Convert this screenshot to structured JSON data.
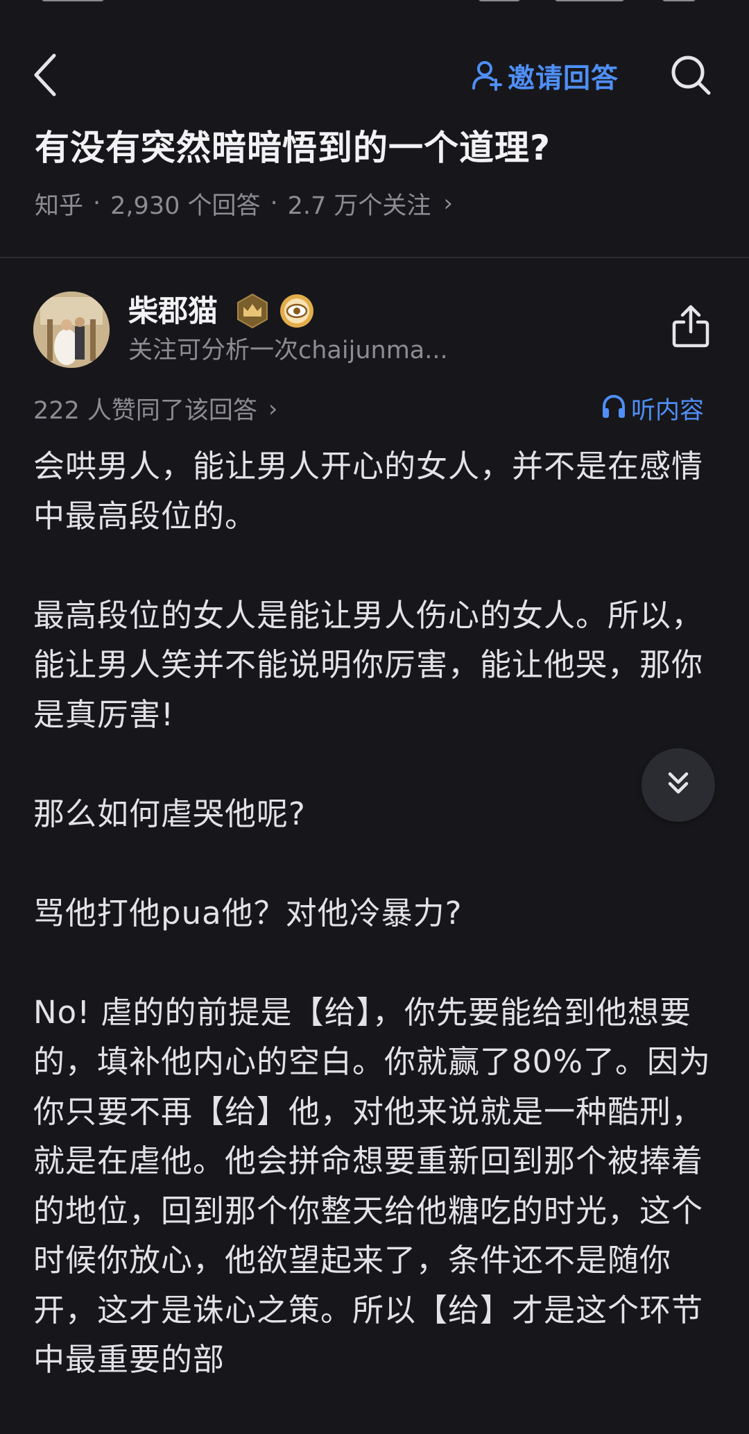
{
  "header": {
    "invite_label": "邀请回答",
    "colors": {
      "accent": "#4f8ff7",
      "background": "#17171b"
    }
  },
  "question": {
    "title": "有没有突然暗暗悟到的一个道理?",
    "source": "知乎",
    "answers": "2,930 个回答",
    "followers": "2.7 万个关注"
  },
  "author": {
    "name": "柴郡猫",
    "bio": "关注可分析一次chaijunma..."
  },
  "answer": {
    "votes": "222 人赞同了该回答",
    "listen_label": "听内容",
    "paragraphs": [
      "会哄男人，能让男人开心的女人，并不是在感情中最高段位的。",
      "最高段位的女人是能让男人伤心的女人。所以，能让男人笑并不能说明你厉害，能让他哭，那你是真厉害!",
      "那么如何虐哭他呢?",
      "骂他打他pua他？对他冷暴力?",
      "No! 虐的的前提是【给】，你先要能给到他想要的，填补他内心的空白。你就赢了80%了。因为你只要不再【给】他，对他来说就是一种酷刑，就是在虐他。他会拼命想要重新回到那个被捧着的地位，回到那个你整天给他糖吃的时光，这个时候你放心，他欲望起来了，条件还不是随你开，这才是诛心之策。所以【给】才是这个环节中最重要的部"
    ]
  }
}
